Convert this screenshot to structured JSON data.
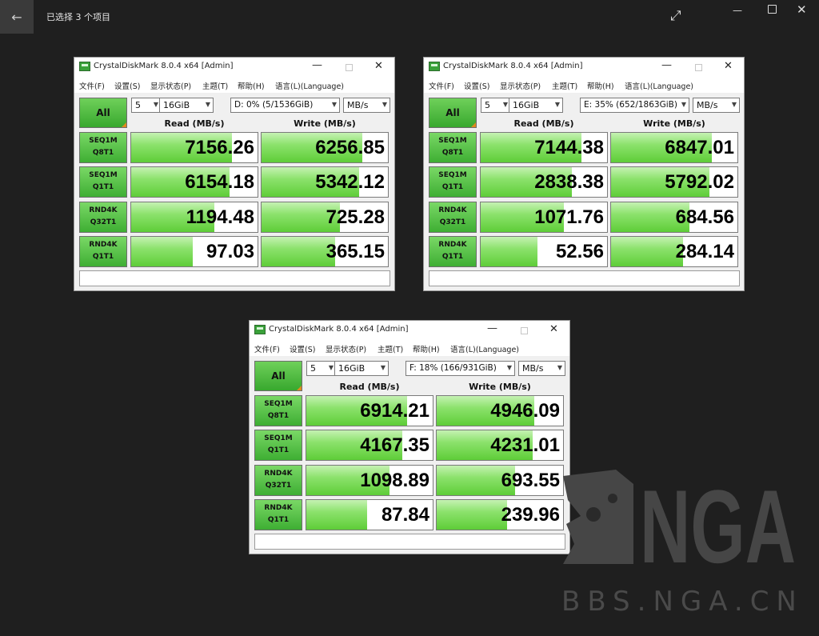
{
  "viewer": {
    "title": "已选择 3 个项目",
    "back_icon": "back-arrow-icon",
    "expand_icon": "expand-icon"
  },
  "windows": [
    {
      "title": "CrystalDiskMark 8.0.4 x64 [Admin]",
      "menu": [
        "文件(F)",
        "设置(S)",
        "显示状态(P)",
        "主题(T)",
        "帮助(H)",
        "语言(L)(Language)"
      ],
      "all_label": "All",
      "count": "5",
      "size": "16GiB",
      "drive": "D: 0% (5/1536GiB)",
      "unit": "MB/s",
      "read_header": "Read (MB/s)",
      "write_header": "Write (MB/s)",
      "tests": [
        {
          "line1": "SEQ1M",
          "line2": "Q8T1",
          "read": "7156.26",
          "write": "6256.85",
          "read_fill": 0.8,
          "write_fill": 0.8
        },
        {
          "line1": "SEQ1M",
          "line2": "Q1T1",
          "read": "6154.18",
          "write": "5342.12",
          "read_fill": 0.78,
          "write_fill": 0.77
        },
        {
          "line1": "RND4K",
          "line2": "Q32T1",
          "read": "1194.48",
          "write": "725.28",
          "read_fill": 0.66,
          "write_fill": 0.62
        },
        {
          "line1": "RND4K",
          "line2": "Q1T1",
          "read": "97.03",
          "write": "365.15",
          "read_fill": 0.49,
          "write_fill": 0.58
        }
      ]
    },
    {
      "title": "CrystalDiskMark 8.0.4 x64 [Admin]",
      "menu": [
        "文件(F)",
        "设置(S)",
        "显示状态(P)",
        "主题(T)",
        "帮助(H)",
        "语言(L)(Language)"
      ],
      "all_label": "All",
      "count": "5",
      "size": "16GiB",
      "drive": "E: 35% (652/1863GiB)",
      "unit": "MB/s",
      "read_header": "Read (MB/s)",
      "write_header": "Write (MB/s)",
      "tests": [
        {
          "line1": "SEQ1M",
          "line2": "Q8T1",
          "read": "7144.38",
          "write": "6847.01",
          "read_fill": 0.8,
          "write_fill": 0.8
        },
        {
          "line1": "SEQ1M",
          "line2": "Q1T1",
          "read": "2838.38",
          "write": "5792.02",
          "read_fill": 0.72,
          "write_fill": 0.78
        },
        {
          "line1": "RND4K",
          "line2": "Q32T1",
          "read": "1071.76",
          "write": "684.56",
          "read_fill": 0.66,
          "write_fill": 0.62
        },
        {
          "line1": "RND4K",
          "line2": "Q1T1",
          "read": "52.56",
          "write": "284.14",
          "read_fill": 0.45,
          "write_fill": 0.57
        }
      ]
    },
    {
      "title": "CrystalDiskMark 8.0.4 x64 [Admin]",
      "menu": [
        "文件(F)",
        "设置(S)",
        "显示状态(P)",
        "主题(T)",
        "帮助(H)",
        "语言(L)(Language)"
      ],
      "all_label": "All",
      "count": "5",
      "size": "16GiB",
      "drive": "F: 18% (166/931GiB)",
      "unit": "MB/s",
      "read_header": "Read (MB/s)",
      "write_header": "Write (MB/s)",
      "tests": [
        {
          "line1": "SEQ1M",
          "line2": "Q8T1",
          "read": "6914.21",
          "write": "4946.09",
          "read_fill": 0.8,
          "write_fill": 0.77
        },
        {
          "line1": "SEQ1M",
          "line2": "Q1T1",
          "read": "4167.35",
          "write": "4231.01",
          "read_fill": 0.76,
          "write_fill": 0.76
        },
        {
          "line1": "RND4K",
          "line2": "Q32T1",
          "read": "1098.89",
          "write": "693.55",
          "read_fill": 0.66,
          "write_fill": 0.62
        },
        {
          "line1": "RND4K",
          "line2": "Q1T1",
          "read": "87.84",
          "write": "239.96",
          "read_fill": 0.48,
          "write_fill": 0.56
        }
      ]
    }
  ],
  "watermark": {
    "logo": "NGA",
    "url": "BBS.NGA.CN"
  }
}
